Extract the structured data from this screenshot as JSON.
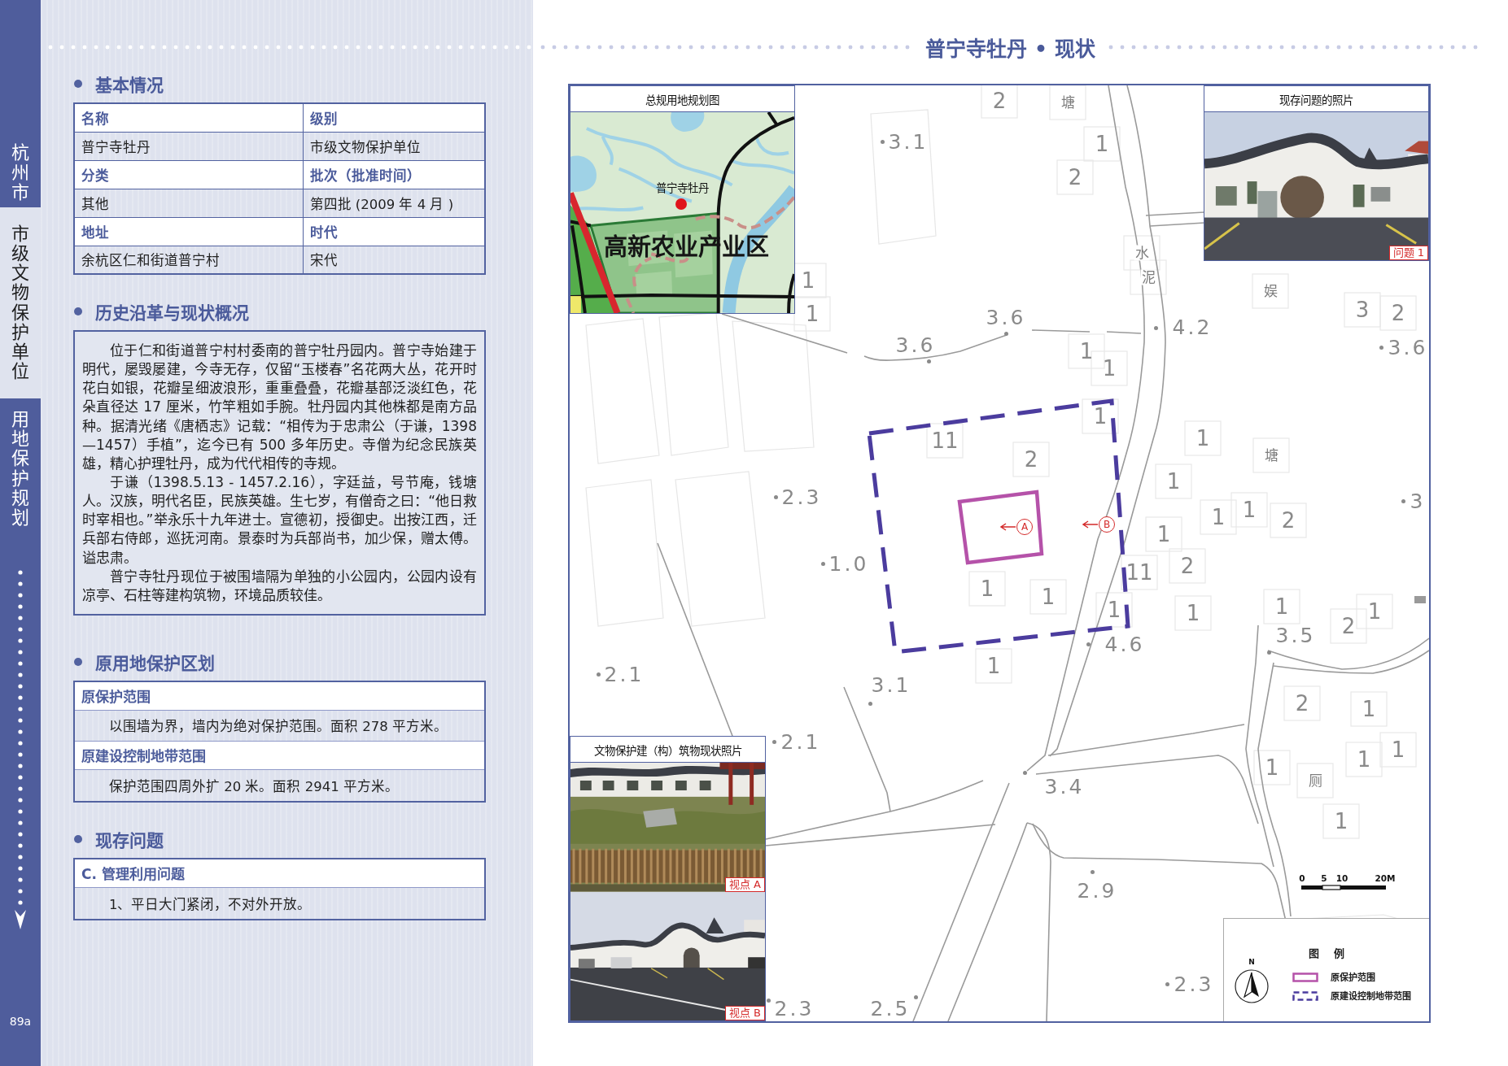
{
  "sidebar": {
    "city": "杭州市",
    "category": "市级文物保护单位",
    "chapter": "用地保护规划",
    "page_number": "89a"
  },
  "title": "普宁寺牡丹 • 现状",
  "sections": [
    {
      "kind": "table",
      "heading": "基本情况",
      "rows": [
        {
          "kind": "header",
          "cells": [
            "名称",
            "级别"
          ]
        },
        {
          "kind": "value",
          "cells": [
            "普宁寺牡丹",
            "市级文物保护单位"
          ]
        },
        {
          "kind": "header",
          "cells": [
            "分类",
            "批次（批准时间）"
          ]
        },
        {
          "kind": "value",
          "cells": [
            "其他",
            "第四批 (2009 年 4 月 )"
          ]
        },
        {
          "kind": "header",
          "cells": [
            "地址",
            "时代"
          ]
        },
        {
          "kind": "value",
          "cells": [
            "余杭区仁和街道普宁村",
            "宋代"
          ]
        }
      ]
    },
    {
      "kind": "text",
      "heading": "历史沿革与现状概况",
      "paragraphs": [
        "位于仁和街道普宁村村委南的普宁牡丹园内。普宁寺始建于明代，屡毁屡建，今寺无存，仅留“玉楼春”名花两大丛，花开时花白如银，花瓣呈细波浪形，重重叠叠，花瓣基部泛淡红色，花朵直径达 17 厘米，竹竿粗如手腕。牡丹园内其他株都是南方品种。据清光绪《唐栖志》记载：“相传为于忠肃公（于谦，1398—1457）手植”，迄今已有 500 多年历史。寺僧为纪念民族英雄，精心护理牡丹，成为代代相传的寺规。",
        "于谦（1398.5.13 - 1457.2.16），字廷益，号节庵，钱塘人。汉族，明代名臣，民族英雄。生七岁，有僧奇之曰：“他日救时宰相也。”举永乐十九年进士。宣德初，授御史。出按江西，迁兵部右侍郎，巡抚河南。景泰时为兵部尚书，加少保，赠太傅。谥忠肃。",
        "普宁寺牡丹现位于被围墙隔为单独的小公园内，公园内设有凉亭、石柱等建构筑物，环境品质较佳。"
      ]
    },
    {
      "kind": "blocks",
      "heading": "原用地保护区划",
      "blocks": [
        {
          "label": "原保护范围",
          "text": "以围墙为界，墙内为绝对保护范围。面积 278 平方米。"
        },
        {
          "label": "原建设控制地带范围",
          "text": "保护范围四周外扩 20 米。面积 2941 平方米。"
        }
      ]
    },
    {
      "kind": "blocks",
      "heading": "现存问题",
      "blocks": [
        {
          "label": "C. 管理利用问题",
          "text": "1、平日大门紧闭，不对外开放。"
        }
      ]
    }
  ],
  "map": {
    "labels": [
      {
        "kind": "floors",
        "text": "2"
      },
      {
        "kind": "place",
        "text": "塘"
      },
      {
        "kind": "elevation",
        "text": "3.1"
      },
      {
        "kind": "floors",
        "text": "1"
      },
      {
        "kind": "floors",
        "text": "2"
      },
      {
        "kind": "place",
        "text": "水"
      },
      {
        "kind": "floors",
        "text": "1"
      },
      {
        "kind": "place",
        "text": "泥"
      },
      {
        "kind": "place",
        "text": "娱"
      },
      {
        "kind": "floors",
        "text": "1"
      },
      {
        "kind": "elevation",
        "text": "3.6"
      },
      {
        "kind": "elevation",
        "text": "4.2"
      },
      {
        "kind": "floors",
        "text": "3"
      },
      {
        "kind": "floors",
        "text": "2"
      },
      {
        "kind": "elevation",
        "text": "3.6"
      },
      {
        "kind": "floors",
        "text": "1"
      },
      {
        "kind": "elevation",
        "text": "3.6"
      },
      {
        "kind": "floors",
        "text": "1"
      },
      {
        "kind": "floors",
        "text": "1"
      },
      {
        "kind": "floors",
        "text": "11"
      },
      {
        "kind": "floors",
        "text": "1"
      },
      {
        "kind": "floors",
        "text": "2"
      },
      {
        "kind": "place",
        "text": "塘"
      },
      {
        "kind": "floors",
        "text": "1"
      },
      {
        "kind": "elevation",
        "text": "2.3"
      },
      {
        "kind": "elevation",
        "text": "3"
      },
      {
        "kind": "floors",
        "text": "1"
      },
      {
        "kind": "floors",
        "text": "1"
      },
      {
        "kind": "floors",
        "text": "1"
      },
      {
        "kind": "floors",
        "text": "2"
      },
      {
        "kind": "elevation",
        "text": "1.0"
      },
      {
        "kind": "floors",
        "text": "11"
      },
      {
        "kind": "floors",
        "text": "2"
      },
      {
        "kind": "floors",
        "text": "1"
      },
      {
        "kind": "floors",
        "text": "1"
      },
      {
        "kind": "floors",
        "text": "1"
      },
      {
        "kind": "floors",
        "text": "1"
      },
      {
        "kind": "floors",
        "text": "1"
      },
      {
        "kind": "floors",
        "text": "1"
      },
      {
        "kind": "elevation",
        "text": "4.6"
      },
      {
        "kind": "elevation",
        "text": "3.5"
      },
      {
        "kind": "floors",
        "text": "2"
      },
      {
        "kind": "elevation",
        "text": "2.1"
      },
      {
        "kind": "elevation",
        "text": "3.1"
      },
      {
        "kind": "floors",
        "text": "1"
      },
      {
        "kind": "floors",
        "text": "2"
      },
      {
        "kind": "floors",
        "text": "1"
      },
      {
        "kind": "elevation",
        "text": "2.1"
      },
      {
        "kind": "floors",
        "text": "1"
      },
      {
        "kind": "floors",
        "text": "1"
      },
      {
        "kind": "floors",
        "text": "1"
      },
      {
        "kind": "elevation",
        "text": "3.4"
      },
      {
        "kind": "place",
        "text": "厕"
      },
      {
        "kind": "floors",
        "text": "1"
      },
      {
        "kind": "elevation",
        "text": "2.9"
      },
      {
        "kind": "elevation",
        "text": "2.3"
      },
      {
        "kind": "elevation",
        "text": "2.3"
      },
      {
        "kind": "elevation",
        "text": "2.5"
      }
    ],
    "viewpoints": [
      "A",
      "B"
    ],
    "insets": [
      {
        "kind": "plan",
        "title": "总规用地规划图",
        "site_label": "普宁寺牡丹",
        "zone_label": "高新农业产业区"
      },
      {
        "kind": "photos",
        "title": "现存问题的照片",
        "photos": [
          {
            "tag": "问题 1"
          }
        ]
      },
      {
        "kind": "photos",
        "title": "文物保护建（构）筑物现状照片",
        "photos": [
          {
            "tag": "视点 A"
          },
          {
            "tag": "视点 B"
          }
        ]
      }
    ],
    "scale_ticks": [
      "0",
      "5",
      "10",
      "20M"
    ],
    "compass_label": "N",
    "legend": {
      "title": "图 例",
      "items": [
        {
          "kind": "solid",
          "label": "原保护范围",
          "color": "#b552a9"
        },
        {
          "kind": "dashed",
          "label": "原建设控制地带范围",
          "color": "#4b3c9e"
        }
      ]
    }
  }
}
